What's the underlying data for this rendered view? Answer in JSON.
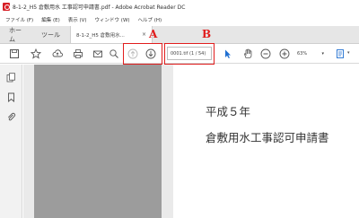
{
  "window": {
    "title": "8-1-2_H5 倉敷用水 工事認可申請書.pdf - Adobe Acrobat Reader DC"
  },
  "menu": {
    "items": [
      "ファイル (F)",
      "編集 (E)",
      "表示 (V)",
      "ウィンドウ (W)",
      "ヘルプ (H)"
    ]
  },
  "tabs": {
    "home": "ホーム",
    "tools": "ツール",
    "document": "8-1-2_H5 倉敷用水...",
    "close": "×"
  },
  "toolbar": {
    "page_number": "0001.tif",
    "page_total": "(1 / 54)",
    "zoom": "63%",
    "zoom_arrow": "▾"
  },
  "annotations": {
    "label_a": "A",
    "label_b": "B",
    "accent_color": "#e11d1d"
  },
  "document": {
    "line1": "平成５年",
    "line2": "倉敷用水工事認可申請書"
  }
}
